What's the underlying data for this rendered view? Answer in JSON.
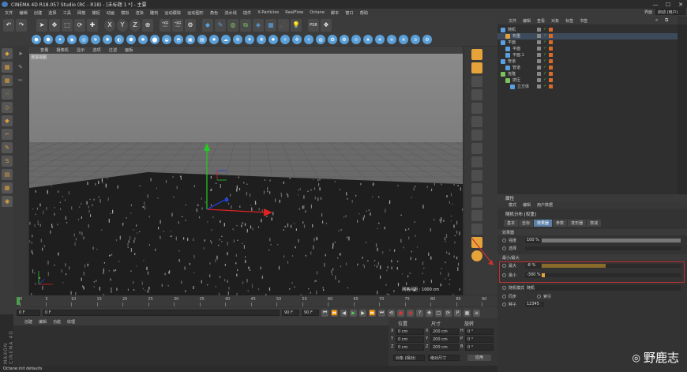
{
  "window": {
    "title": "CINEMA 4D R18.057 Studio (RC - R18) - [未标题 1 *] - 主要"
  },
  "menu": [
    "文件",
    "编辑",
    "创建",
    "选择",
    "工具",
    "网格",
    "捕捉",
    "动画",
    "模拟",
    "渲染",
    "雕刻",
    "运动跟踪",
    "运动图形",
    "角色",
    "流水线",
    "插件",
    "X-Particles",
    "RealFlow",
    "Octane",
    "脚本",
    "窗口",
    "帮助"
  ],
  "layout": {
    "label": "界面",
    "value": "启动 (用户)"
  },
  "viewport": {
    "menu": [
      "查看",
      "摄像机",
      "显示",
      "选项",
      "过滤",
      "面板"
    ],
    "label": "透视视图",
    "grid_spacing": "网格间距 : 1000 cm"
  },
  "timeline": {
    "ticks": [
      "0",
      "5",
      "10",
      "15",
      "20",
      "25",
      "30",
      "35",
      "40",
      "45",
      "50",
      "55",
      "60",
      "65",
      "70",
      "75",
      "80",
      "85",
      "90"
    ],
    "current_frame": "0 F",
    "start_field": "0 F",
    "end_field": "90 F",
    "end_field2": "90 F",
    "frame_end_label": "0 F"
  },
  "material_manager": {
    "menu": [
      "创建",
      "编辑",
      "功能",
      "纹理"
    ]
  },
  "coordinates": {
    "headers": [
      "位置",
      "尺寸",
      "旋转"
    ],
    "rows": [
      {
        "axis": "X",
        "pos": "0 cm",
        "size": "200 cm",
        "rot_axis": "H",
        "rot": "0 °"
      },
      {
        "axis": "Y",
        "pos": "0 cm",
        "size": "200 cm",
        "rot_axis": "P",
        "rot": "0 °"
      },
      {
        "axis": "Z",
        "pos": "0 cm",
        "size": "200 cm",
        "rot_axis": "B",
        "rot": "0 °"
      }
    ],
    "mode_object": "对象 (相对)",
    "mode_size": "绝对尺寸",
    "apply": "应用"
  },
  "status": "Octane:init defaults",
  "object_manager": {
    "tabs": [
      "文件",
      "编辑",
      "查看",
      "对象",
      "标签",
      "书签"
    ],
    "objects": [
      {
        "name": "随机",
        "indent": 0,
        "color": "#5aa0e0"
      },
      {
        "name": "权重",
        "indent": 1,
        "color": "#e0a040",
        "selected": true
      },
      {
        "name": "平面",
        "indent": 0,
        "color": "#5aa0e0"
      },
      {
        "name": "平面",
        "indent": 1,
        "color": "#5aa0e0"
      },
      {
        "name": "平面.1",
        "indent": 1,
        "color": "#5aa0e0"
      },
      {
        "name": "管道",
        "indent": 0,
        "color": "#5aa0e0"
      },
      {
        "name": "管道",
        "indent": 1,
        "color": "#5aa0e0"
      },
      {
        "name": "克隆",
        "indent": 0,
        "color": "#7cc060"
      },
      {
        "name": "挤压",
        "indent": 1,
        "color": "#7cc060"
      },
      {
        "name": "立方体",
        "indent": 2,
        "color": "#5aa0e0"
      }
    ]
  },
  "attributes": {
    "header": "属性",
    "menu": [
      "模式",
      "编辑",
      "用户数据"
    ],
    "object_name": "随机分布 [权重]",
    "tabs": [
      "基本",
      "坐标",
      "效果器",
      "参数",
      "变形器",
      "衰减"
    ],
    "active_tab": "效果器",
    "section": "效果器",
    "strength_label": "强度",
    "strength_value": "100 %",
    "strength_fill": 1.0,
    "select_label": "选择",
    "minmax_section": "最小/最大",
    "max_label": "最大",
    "max_value": "-8 %",
    "max_fill": 0.46,
    "min_label": "最小",
    "min_value": "-300 %",
    "min_fill": 0.02,
    "random_mode_label": "随机模式",
    "random_mode_value": "随机",
    "sync_label": "同步",
    "index_label": "索引",
    "seed_label": "种子",
    "seed_value": "12345"
  },
  "watermark": "野鹿志"
}
